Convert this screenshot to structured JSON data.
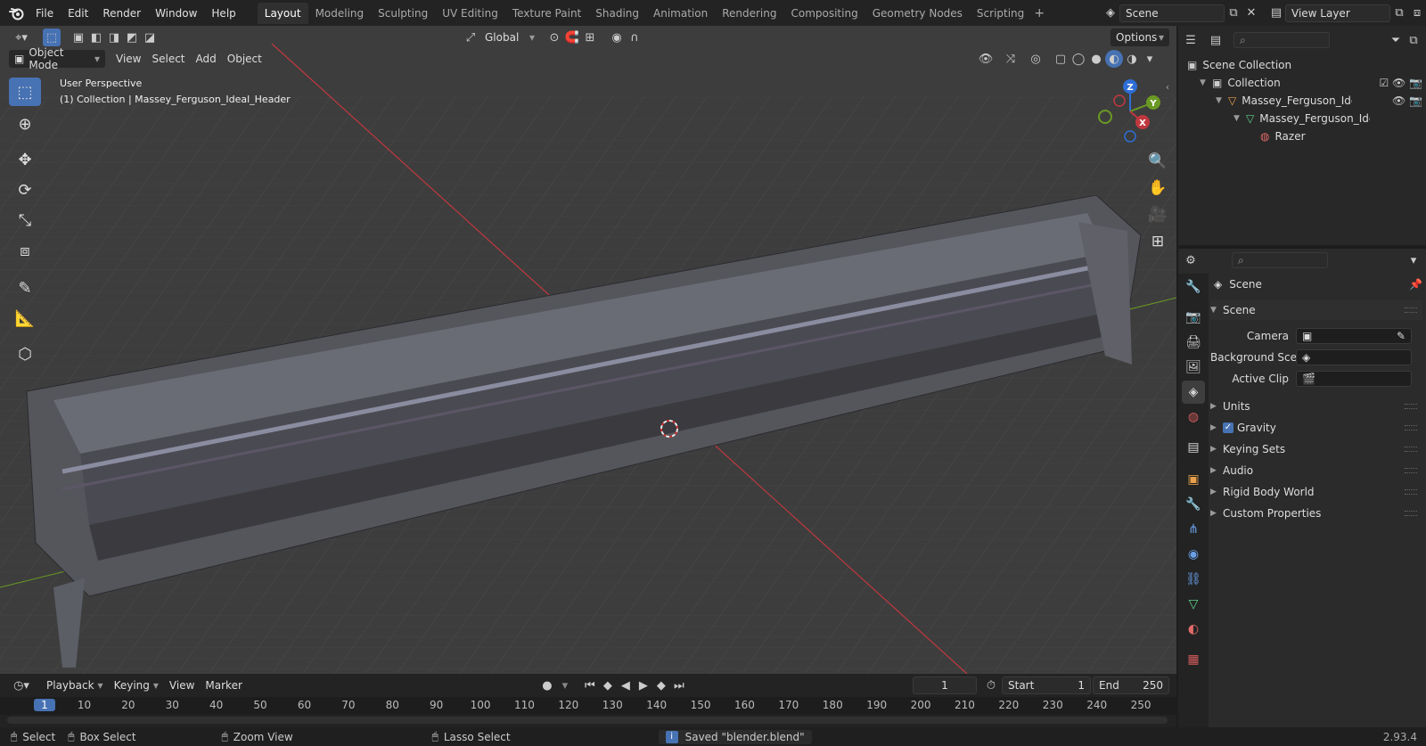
{
  "menu": [
    "File",
    "Edit",
    "Render",
    "Window",
    "Help"
  ],
  "workspaces": [
    "Layout",
    "Modeling",
    "Sculpting",
    "UV Editing",
    "Texture Paint",
    "Shading",
    "Animation",
    "Rendering",
    "Compositing",
    "Geometry Nodes",
    "Scripting"
  ],
  "active_workspace": "Layout",
  "scene_field": "Scene",
  "view_layer_field": "View Layer",
  "viewport": {
    "transform_orientation": "Global",
    "options_label": "Options",
    "mode": "Object Mode",
    "header_menus": [
      "View",
      "Select",
      "Add",
      "Object"
    ],
    "info_line1": "User Perspective",
    "info_line2": "(1) Collection | Massey_Ferguson_Ideal_Header",
    "gizmo": {
      "z": "Z",
      "y": "Y",
      "x": "X"
    }
  },
  "outliner": {
    "root": "Scene Collection",
    "collection": "Collection",
    "object": "Massey_Ferguson_Ideal_I",
    "mesh": "Massey_Ferguson_Ide",
    "material": "Razer"
  },
  "properties": {
    "context_title": "Scene",
    "panel_title": "Scene",
    "camera_label": "Camera",
    "background_label": "Background Sce...",
    "clip_label": "Active Clip",
    "collapsed_panels": [
      "Units",
      "Gravity",
      "Keying Sets",
      "Audio",
      "Rigid Body World",
      "Custom Properties"
    ],
    "gravity_checked": true
  },
  "timeline": {
    "menus": [
      "Playback",
      "Keying",
      "View",
      "Marker"
    ],
    "current_frame": "1",
    "start_label": "Start",
    "start_value": "1",
    "end_label": "End",
    "end_value": "250",
    "ruler": [
      "1",
      "10",
      "20",
      "30",
      "40",
      "50",
      "60",
      "70",
      "80",
      "90",
      "100",
      "110",
      "120",
      "130",
      "140",
      "150",
      "160",
      "170",
      "180",
      "190",
      "200",
      "210",
      "220",
      "230",
      "240",
      "250"
    ]
  },
  "status": {
    "select": "Select",
    "box_select": "Box Select",
    "zoom_view": "Zoom View",
    "lasso_select": "Lasso Select",
    "message": "Saved \"blender.blend\"",
    "version": "2.93.4"
  },
  "colors": {
    "accent": "#4772b3",
    "x_axis": "#c0383f",
    "y_axis": "#6a9a23",
    "z_axis": "#2d6fd6"
  }
}
